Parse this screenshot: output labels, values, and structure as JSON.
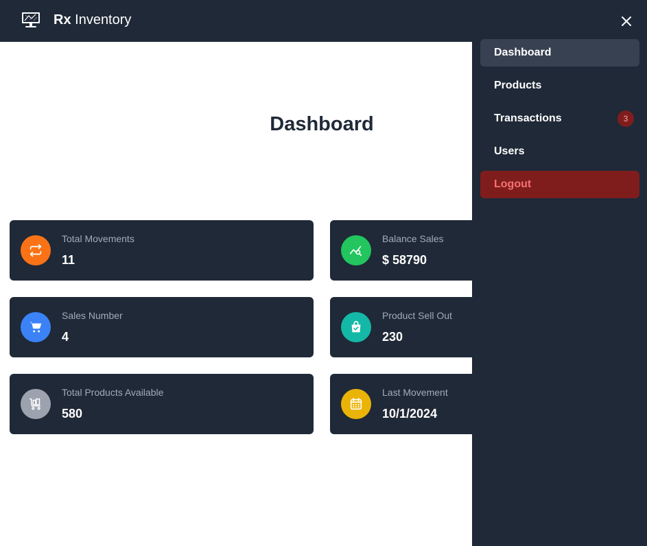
{
  "app": {
    "title_bold": "Rx",
    "title_rest": " Inventory"
  },
  "page": {
    "title": "Dashboard"
  },
  "cards": [
    {
      "label": "Total Movements",
      "value": "11",
      "icon": "arrows-exchange-icon",
      "color": "#f97316"
    },
    {
      "label": "Balance Sales",
      "value": "$ 58790",
      "icon": "chart-search-icon",
      "color": "#22c55e"
    },
    {
      "label": "Sales Number",
      "value": "4",
      "icon": "cart-icon",
      "color": "#3b82f6"
    },
    {
      "label": "Product Sell Out",
      "value": "230",
      "icon": "shopping-bag-check-icon",
      "color": "#14b8a6"
    },
    {
      "label": "Total Products Available",
      "value": "580",
      "icon": "trolley-icon",
      "color": "#9ca3af"
    },
    {
      "label": "Last Movement",
      "value": "10/1/2024",
      "icon": "calendar-icon",
      "color": "#eab308"
    }
  ],
  "sidebar": {
    "items": [
      {
        "label": "Dashboard"
      },
      {
        "label": "Products"
      },
      {
        "label": "Transactions",
        "badge": "3"
      },
      {
        "label": "Users"
      },
      {
        "label": "Logout"
      }
    ]
  }
}
